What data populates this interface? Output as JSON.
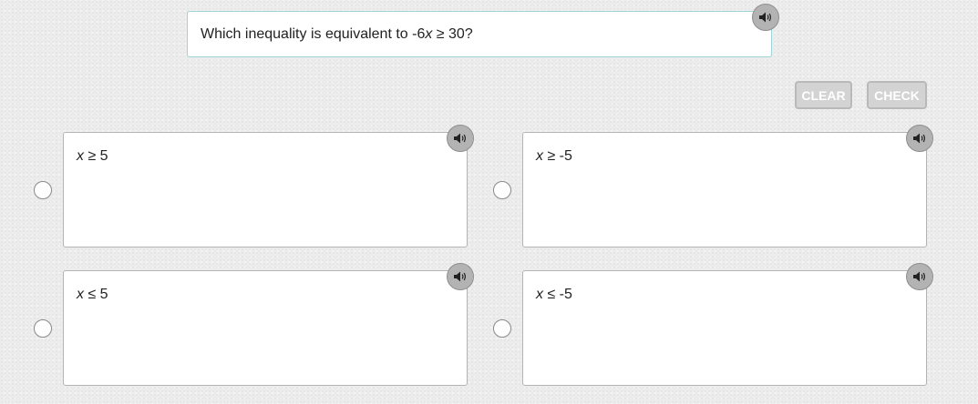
{
  "question": {
    "prefix": "Which inequality is equivalent to -6",
    "variable": "x",
    "suffix": " ≥ 30?"
  },
  "buttons": {
    "clear_label": "CLEAR",
    "check_label": "CHECK"
  },
  "options": [
    {
      "variable": "x",
      "rest": " ≥ 5"
    },
    {
      "variable": "x",
      "rest": " ≥ -5"
    },
    {
      "variable": "x",
      "rest": " ≤ 5"
    },
    {
      "variable": "x",
      "rest": " ≤ -5"
    }
  ],
  "icons": {
    "audio": "speaker-icon"
  },
  "colors": {
    "button_bg": "#d3d3d3",
    "button_text": "#ffffff",
    "speaker_bg": "#b3b3b3",
    "question_border": "#9fd3d8"
  }
}
